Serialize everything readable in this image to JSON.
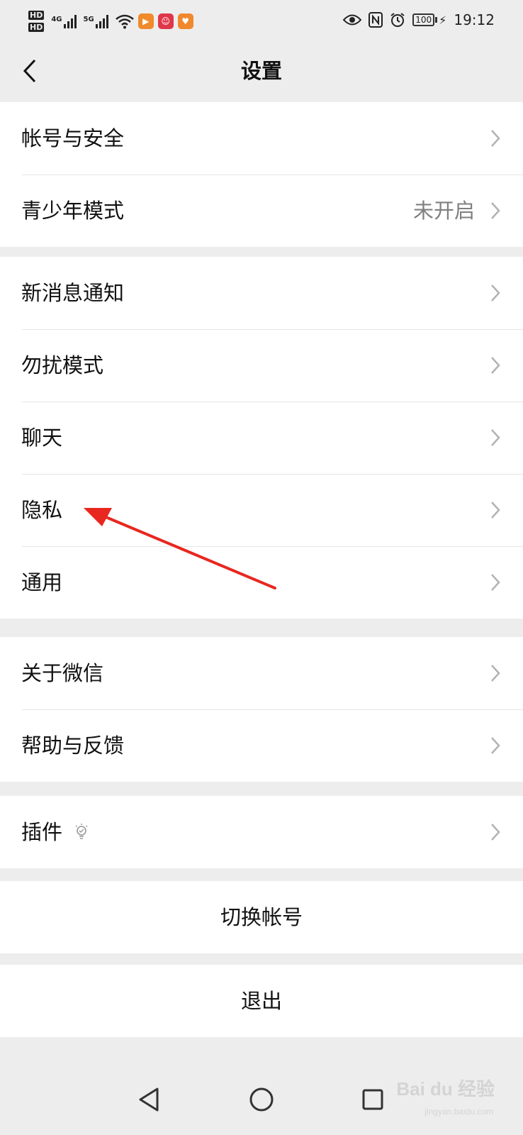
{
  "status_bar": {
    "hd1": "HD",
    "hd2": "HD",
    "net1": "4G",
    "net2": "5G",
    "battery": "100",
    "time": "19:12"
  },
  "nav": {
    "title": "设置"
  },
  "groups": [
    {
      "items": [
        {
          "label": "帐号与安全",
          "value": ""
        },
        {
          "label": "青少年模式",
          "value": "未开启"
        }
      ]
    },
    {
      "items": [
        {
          "label": "新消息通知",
          "value": ""
        },
        {
          "label": "勿扰模式",
          "value": ""
        },
        {
          "label": "聊天",
          "value": ""
        },
        {
          "label": "隐私",
          "value": ""
        },
        {
          "label": "通用",
          "value": ""
        }
      ]
    },
    {
      "items": [
        {
          "label": "关于微信",
          "value": ""
        },
        {
          "label": "帮助与反馈",
          "value": ""
        }
      ]
    },
    {
      "items": [
        {
          "label": "插件",
          "value": ""
        }
      ]
    }
  ],
  "actions": {
    "switch_account": "切换帐号",
    "logout": "退出"
  },
  "watermark": {
    "brand": "Bai du 经验",
    "sub": "jingyan.baidu.com"
  },
  "colors": {
    "background": "#ededed",
    "card": "#ffffff",
    "text": "#111111",
    "secondary_text": "#808080",
    "annotation_arrow": "#e8271f"
  },
  "icons": {
    "back": "chevron-left-icon",
    "row": "chevron-right-icon",
    "plugin": "lightbulb-icon"
  }
}
